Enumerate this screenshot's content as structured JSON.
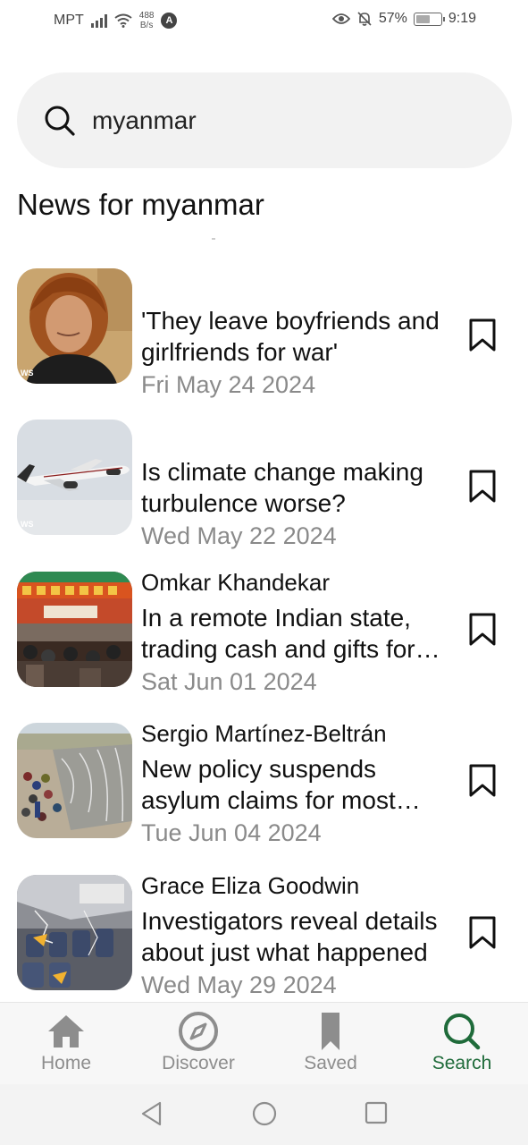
{
  "status_bar": {
    "carrier": "MPT",
    "speed_value": "488",
    "speed_unit": "B/s",
    "nav_badge": "A",
    "battery": "57%",
    "battery_level": 0.57,
    "time": "9:19"
  },
  "search": {
    "value": "myanmar",
    "icon": "search-icon"
  },
  "section_title": "News for myanmar",
  "articles": [
    {
      "author": "",
      "headline": "'They leave boyfriends and girlfriends for war'",
      "date": "Fri May 24 2024",
      "source_mark": "WS"
    },
    {
      "author": "",
      "headline": "Is climate change making turbulence worse?",
      "date": "Wed May 22 2024",
      "source_mark": "WS"
    },
    {
      "author": "Omkar Khandekar",
      "headline": "In a remote Indian state, trading cash and gifts for votes",
      "date": "Sat Jun 01 2024"
    },
    {
      "author": "Sergio Martínez-Beltrán",
      "headline": "New policy suspends asylum claims for most migrants",
      "date": "Tue Jun 04 2024"
    },
    {
      "author": "Grace Eliza Goodwin",
      "headline": "Investigators reveal details about just what happened",
      "date": "Wed May 29 2024"
    }
  ],
  "bottom_nav": {
    "items": [
      {
        "label": "Home",
        "icon": "home-icon"
      },
      {
        "label": "Discover",
        "icon": "compass-icon"
      },
      {
        "label": "Saved",
        "icon": "bookmark-icon"
      },
      {
        "label": "Search",
        "icon": "search-icon"
      }
    ],
    "active": "Search"
  },
  "colors": {
    "accent": "#1f6b3a",
    "inactive": "#8d8d8d",
    "search_bg": "#f2f2f2"
  }
}
